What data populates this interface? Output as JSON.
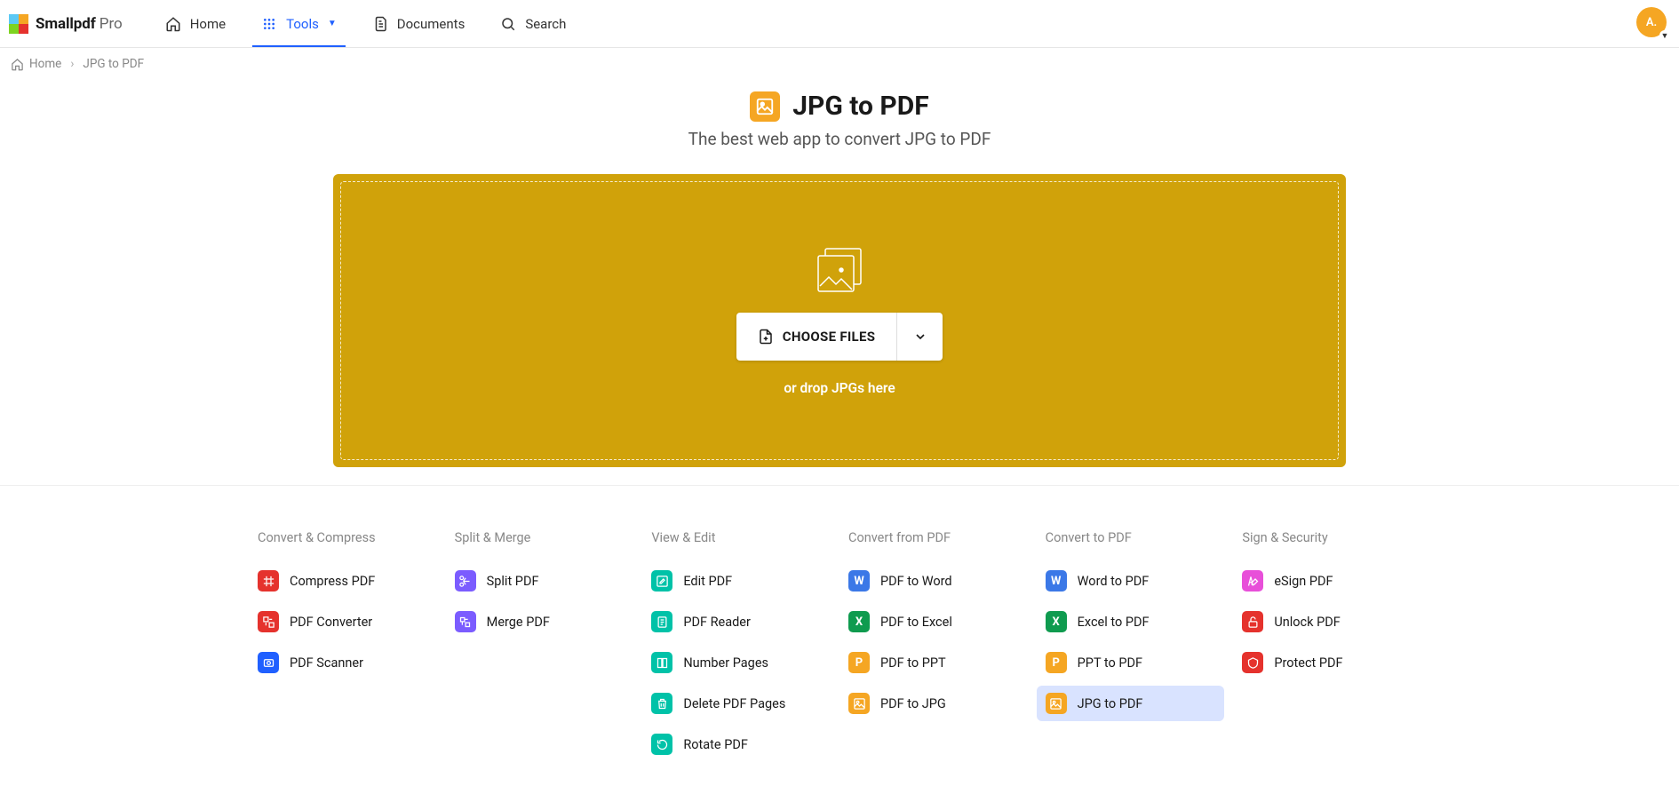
{
  "brand": {
    "name": "Smallpdf",
    "tier": "Pro"
  },
  "nav": {
    "home": "Home",
    "tools": "Tools",
    "documents": "Documents",
    "search": "Search"
  },
  "avatar": {
    "initials": "A."
  },
  "breadcrumb": {
    "home": "Home",
    "current": "JPG to PDF"
  },
  "hero": {
    "title": "JPG to PDF",
    "subtitle": "The best web app to convert JPG to PDF"
  },
  "dropzone": {
    "choose": "CHOOSE FILES",
    "hint": "or drop JPGs here"
  },
  "tool_columns": [
    {
      "title": "Convert & Compress",
      "items": [
        {
          "label": "Compress PDF",
          "color": "#e5322d",
          "icon": "compress"
        },
        {
          "label": "PDF Converter",
          "color": "#e5322d",
          "icon": "convert"
        },
        {
          "label": "PDF Scanner",
          "color": "#2060ff",
          "icon": "scan"
        }
      ]
    },
    {
      "title": "Split & Merge",
      "items": [
        {
          "label": "Split PDF",
          "color": "#7b5cff",
          "icon": "split"
        },
        {
          "label": "Merge PDF",
          "color": "#7b5cff",
          "icon": "merge"
        }
      ]
    },
    {
      "title": "View & Edit",
      "items": [
        {
          "label": "Edit PDF",
          "color": "#00c2a8",
          "icon": "edit"
        },
        {
          "label": "PDF Reader",
          "color": "#00c2a8",
          "icon": "reader"
        },
        {
          "label": "Number Pages",
          "color": "#00c2a8",
          "icon": "number"
        },
        {
          "label": "Delete PDF Pages",
          "color": "#00c2a8",
          "icon": "delete"
        },
        {
          "label": "Rotate PDF",
          "color": "#00c2a8",
          "icon": "rotate"
        }
      ]
    },
    {
      "title": "Convert from PDF",
      "items": [
        {
          "label": "PDF to Word",
          "color": "#3b78e7",
          "icon": "W"
        },
        {
          "label": "PDF to Excel",
          "color": "#0f9b4f",
          "icon": "X"
        },
        {
          "label": "PDF to PPT",
          "color": "#f5a623",
          "icon": "P"
        },
        {
          "label": "PDF to JPG",
          "color": "#f5a623",
          "icon": "img"
        }
      ]
    },
    {
      "title": "Convert to PDF",
      "items": [
        {
          "label": "Word to PDF",
          "color": "#3b78e7",
          "icon": "W"
        },
        {
          "label": "Excel to PDF",
          "color": "#0f9b4f",
          "icon": "X"
        },
        {
          "label": "PPT to PDF",
          "color": "#f5a623",
          "icon": "P"
        },
        {
          "label": "JPG to PDF",
          "color": "#f5a623",
          "icon": "img",
          "selected": true
        }
      ]
    },
    {
      "title": "Sign & Security",
      "items": [
        {
          "label": "eSign PDF",
          "color": "#e84fd9",
          "icon": "sign"
        },
        {
          "label": "Unlock PDF",
          "color": "#e5322d",
          "icon": "unlock"
        },
        {
          "label": "Protect PDF",
          "color": "#e5322d",
          "icon": "protect"
        }
      ]
    }
  ]
}
